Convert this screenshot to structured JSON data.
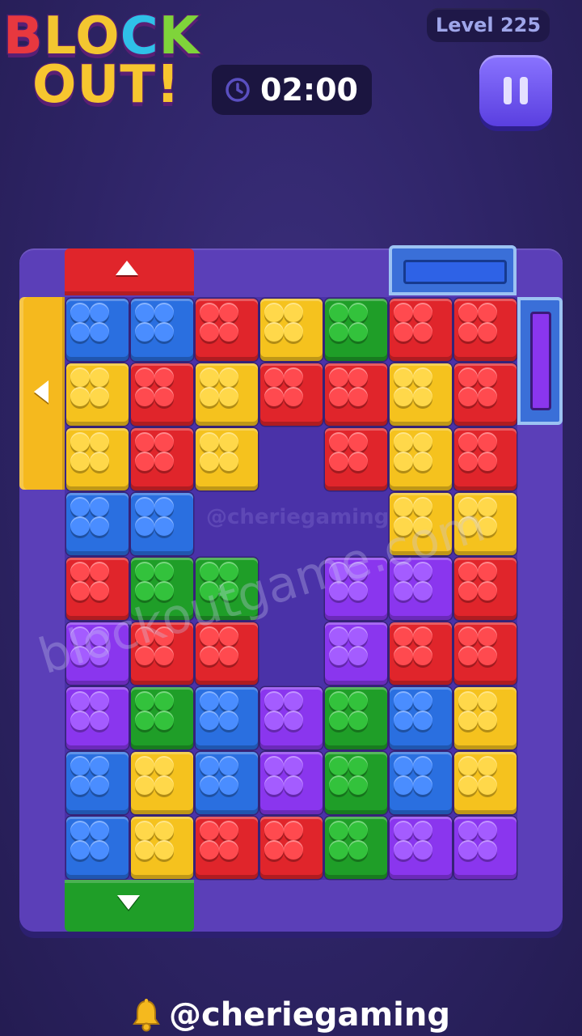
{
  "header": {
    "logo_line1": [
      "B",
      "L",
      "O",
      "C",
      "K"
    ],
    "logo_line2": "OUT!",
    "level_label": "Level 225",
    "timer": "02:00"
  },
  "icons": {
    "timer": "clock-icon",
    "pause": "pause-icon",
    "footer": "bell-icon"
  },
  "colors": {
    "red": "#e0252b",
    "blue": "#2a6fe0",
    "yellow": "#f5c21e",
    "green": "#1f9e28",
    "purple": "#8a36ee"
  },
  "gates": [
    {
      "color": "red",
      "direction": "up"
    },
    {
      "color": "yellow",
      "direction": "left"
    },
    {
      "color": "green",
      "direction": "down"
    },
    {
      "color": "blue",
      "slot_color": "blue"
    },
    {
      "color": "blue",
      "slot_color": "purple"
    }
  ],
  "pieces": [
    {
      "color": "blue",
      "cells": [
        [
          0,
          0
        ],
        [
          1,
          0
        ]
      ]
    },
    {
      "color": "red",
      "cells": [
        [
          2,
          0
        ]
      ]
    },
    {
      "color": "yellow",
      "cells": [
        [
          3,
          0
        ]
      ]
    },
    {
      "color": "green",
      "cells": [
        [
          4,
          0
        ]
      ]
    },
    {
      "color": "red",
      "cells": [
        [
          5,
          0
        ],
        [
          6,
          0
        ],
        [
          6,
          1
        ],
        [
          6,
          2
        ]
      ]
    },
    {
      "color": "yellow",
      "cells": [
        [
          0,
          1
        ],
        [
          0,
          2
        ]
      ]
    },
    {
      "color": "red",
      "cells": [
        [
          1,
          1
        ],
        [
          1,
          2
        ]
      ]
    },
    {
      "color": "yellow",
      "cells": [
        [
          2,
          1
        ],
        [
          2,
          2
        ]
      ]
    },
    {
      "color": "red",
      "cells": [
        [
          3,
          1
        ]
      ]
    },
    {
      "color": "red",
      "cells": [
        [
          4,
          1
        ],
        [
          4,
          2
        ]
      ]
    },
    {
      "color": "yellow",
      "cells": [
        [
          5,
          1
        ],
        [
          5,
          2
        ],
        [
          5,
          3
        ],
        [
          6,
          3
        ]
      ]
    },
    {
      "color": "blue",
      "cells": [
        [
          0,
          3
        ],
        [
          1,
          3
        ]
      ]
    },
    {
      "color": "red",
      "cells": [
        [
          0,
          4
        ]
      ]
    },
    {
      "color": "green",
      "cells": [
        [
          1,
          4
        ],
        [
          2,
          4
        ]
      ]
    },
    {
      "color": "purple",
      "cells": [
        [
          4,
          4
        ],
        [
          5,
          4
        ],
        [
          4,
          5
        ]
      ]
    },
    {
      "color": "red",
      "cells": [
        [
          6,
          4
        ],
        [
          6,
          5
        ],
        [
          5,
          5
        ]
      ]
    },
    {
      "color": "purple",
      "cells": [
        [
          0,
          5
        ],
        [
          0,
          6
        ]
      ]
    },
    {
      "color": "red",
      "cells": [
        [
          1,
          5
        ],
        [
          2,
          5
        ]
      ]
    },
    {
      "color": "green",
      "cells": [
        [
          1,
          6
        ]
      ]
    },
    {
      "color": "blue",
      "cells": [
        [
          2,
          6
        ],
        [
          2,
          7
        ]
      ]
    },
    {
      "color": "purple",
      "cells": [
        [
          3,
          6
        ],
        [
          3,
          7
        ]
      ]
    },
    {
      "color": "green",
      "cells": [
        [
          4,
          6
        ],
        [
          4,
          7
        ],
        [
          4,
          8
        ]
      ]
    },
    {
      "color": "blue",
      "cells": [
        [
          5,
          6
        ],
        [
          5,
          7
        ]
      ]
    },
    {
      "color": "yellow",
      "cells": [
        [
          6,
          6
        ],
        [
          6,
          7
        ]
      ]
    },
    {
      "color": "blue",
      "cells": [
        [
          0,
          7
        ],
        [
          0,
          8
        ]
      ]
    },
    {
      "color": "yellow",
      "cells": [
        [
          1,
          7
        ],
        [
          1,
          8
        ]
      ]
    },
    {
      "color": "red",
      "cells": [
        [
          2,
          8
        ],
        [
          3,
          8
        ]
      ]
    },
    {
      "color": "purple",
      "cells": [
        [
          5,
          8
        ],
        [
          6,
          8
        ]
      ]
    }
  ],
  "watermarks": {
    "small": "@cheriegaming",
    "large": "blockoutgame.com"
  },
  "footer": {
    "handle": "@cheriegaming"
  }
}
